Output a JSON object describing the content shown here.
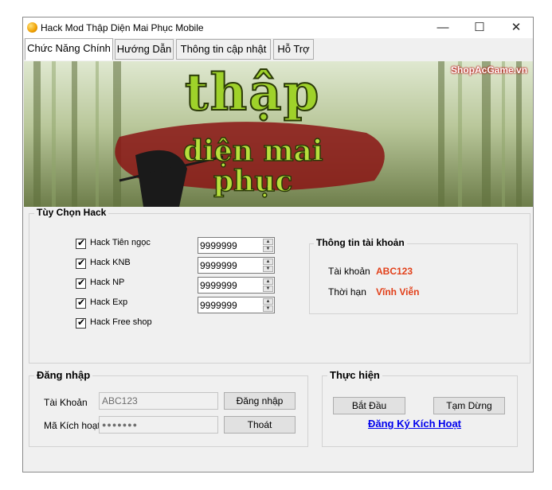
{
  "window": {
    "title": "Hack Mod Thập Diện Mai Phục Mobile",
    "minimize": "—",
    "maximize": "☐",
    "close": "✕"
  },
  "tabs": [
    {
      "label": "Chức Năng Chính"
    },
    {
      "label": "Hướng Dẫn"
    },
    {
      "label": "Thông tin cập nhật"
    },
    {
      "label": "Hỗ Trợ"
    }
  ],
  "banner": {
    "watermark": "ShopAcGame.vn",
    "line1": "thập",
    "line2": "diện mai",
    "line3": "phục"
  },
  "hack_options": {
    "title": "Tùy Chọn Hack",
    "items": [
      {
        "label": "Hack Tiên ngọc",
        "checked": true,
        "value": "9999999"
      },
      {
        "label": "Hack KNB",
        "checked": true,
        "value": "9999999"
      },
      {
        "label": "Hack NP",
        "checked": true,
        "value": "9999999"
      },
      {
        "label": "Hack Exp",
        "checked": true,
        "value": "9999999"
      },
      {
        "label": "Hack Free shop",
        "checked": true
      }
    ]
  },
  "account_info": {
    "title": "Thông tin tài khoản",
    "account_label": "Tài khoản",
    "account_value": "ABC123",
    "term_label": "Thời hạn",
    "term_value": "Vĩnh Viễn"
  },
  "login": {
    "title": "Đăng nhập",
    "account_label": "Tài Khoản",
    "account_value": "ABC123",
    "code_label": "Mã Kích hoạt",
    "code_value": "●●●●●●●",
    "login_button": "Đăng nhập",
    "exit_button": "Thoát"
  },
  "execute": {
    "title": "Thực hiện",
    "start_button": "Bắt Đầu",
    "pause_button": "Tạm Dừng",
    "register_link": "Đăng Ký Kích Hoạt"
  },
  "colors": {
    "accent_red": "#e2401a",
    "link_blue": "#0000ee",
    "banner_green": "#9fd22a"
  },
  "icons": {
    "app": "coin-icon",
    "checkbox": "check-icon",
    "spin_up": "arrow-up-icon",
    "spin_down": "arrow-down-icon"
  }
}
